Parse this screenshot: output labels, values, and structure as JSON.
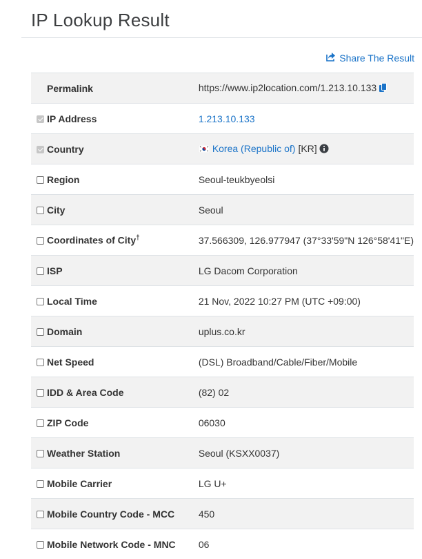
{
  "page": {
    "title": "IP Lookup Result"
  },
  "share": {
    "label": "Share The Result",
    "icon": "share-icon"
  },
  "rows": [
    {
      "label": "Permalink",
      "value": "https://www.ip2location.com/1.213.10.133",
      "checkbox": "none",
      "icon": "copy-icon"
    },
    {
      "label": "IP Address",
      "value": "1.213.10.133",
      "checkbox": "checked-disabled"
    },
    {
      "label": "Country",
      "value": "Korea (Republic of)",
      "suffix": "[KR]",
      "checkbox": "checked-disabled",
      "flag": "south-korea-flag-icon",
      "icon": "info-icon"
    },
    {
      "label": "Region",
      "value": "Seoul-teukbyeolsi",
      "checkbox": "unchecked"
    },
    {
      "label": "City",
      "value": "Seoul",
      "checkbox": "unchecked"
    },
    {
      "label": "Coordinates of City",
      "label_sup": "†",
      "value": "37.566309, 126.977947 (37°33'59\"N   126°58'41\"E)",
      "checkbox": "unchecked"
    },
    {
      "label": "ISP",
      "value": "LG Dacom Corporation",
      "checkbox": "unchecked"
    },
    {
      "label": "Local Time",
      "value": "21 Nov, 2022 10:27 PM (UTC +09:00)",
      "checkbox": "unchecked"
    },
    {
      "label": "Domain",
      "value": "uplus.co.kr",
      "checkbox": "unchecked"
    },
    {
      "label": "Net Speed",
      "value": "(DSL) Broadband/Cable/Fiber/Mobile",
      "checkbox": "unchecked"
    },
    {
      "label": "IDD & Area Code",
      "value": "(82) 02",
      "checkbox": "unchecked"
    },
    {
      "label": "ZIP Code",
      "value": "06030",
      "checkbox": "unchecked"
    },
    {
      "label": "Weather Station",
      "value": "Seoul (KSXX0037)",
      "checkbox": "unchecked"
    },
    {
      "label": "Mobile Carrier",
      "value": "LG U+",
      "checkbox": "unchecked"
    },
    {
      "label": "Mobile Country Code - MCC",
      "value": "450",
      "checkbox": "unchecked"
    },
    {
      "label": "Mobile Network Code - MNC",
      "value": "06",
      "checkbox": "unchecked"
    }
  ],
  "colors": {
    "link": "#1a73c8",
    "stripe": "#f2f2f2",
    "border": "#dee2e6"
  }
}
